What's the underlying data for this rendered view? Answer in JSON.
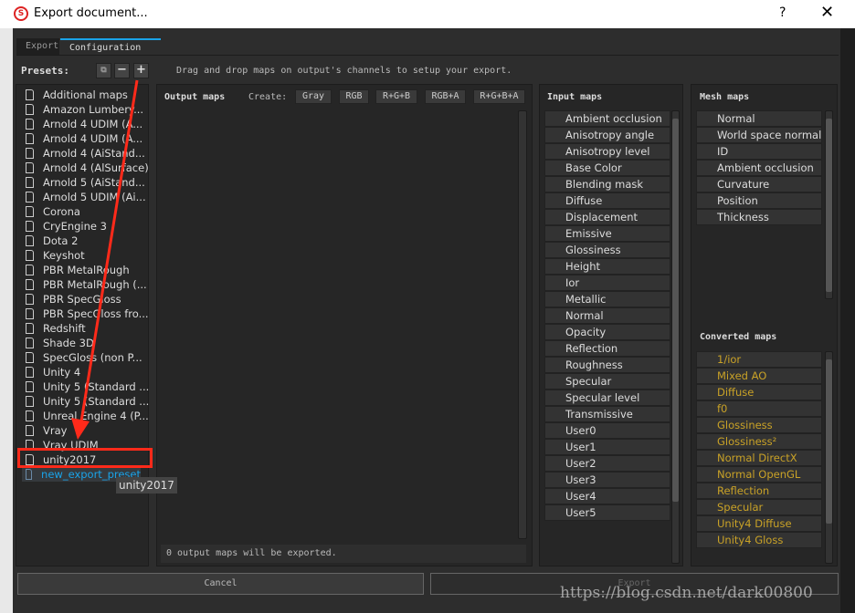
{
  "window": {
    "title": "Export document...",
    "help": "?",
    "close": "✕"
  },
  "tabs": [
    {
      "label": "Export"
    },
    {
      "label": "Configuration",
      "active": true
    }
  ],
  "presets": {
    "label": "Presets:",
    "buttons": [
      "⧉",
      "−",
      "+"
    ],
    "items": [
      "Additional maps",
      "Amazon Lumbery...",
      "Arnold 4  UDIM (A...",
      "Arnold 4  UDIM (A...",
      "Arnold 4 (AiStand...",
      "Arnold 4 (AlSurface)",
      "Arnold 5 (AiStand...",
      "Arnold 5 UDIM (Ai...",
      "Corona",
      "CryEngine 3",
      "Dota 2",
      "Keyshot",
      "PBR MetalRough",
      "PBR MetalRough (...",
      "PBR SpecGloss",
      "PBR SpecGloss fro...",
      "Redshift",
      "Shade 3D",
      "SpecGloss (non P...",
      "Unity 4",
      "Unity 5 (Standard ...",
      "Unity 5 (Standard ...",
      "Unreal Engine 4 (P...",
      "Vray",
      "Vray UDIM",
      "unity2017"
    ],
    "new_item": "new_export_preset",
    "tooltip": "unity2017"
  },
  "hint": "Drag and drop maps on output's channels to setup your export.",
  "output": {
    "title": "Output maps",
    "create_label": "Create:",
    "create_buttons": [
      "Gray",
      "RGB",
      "R+G+B",
      "RGB+A",
      "R+G+B+A"
    ],
    "status": "0 output maps will be exported."
  },
  "input_maps": {
    "title": "Input maps",
    "items": [
      "Ambient occlusion",
      "Anisotropy angle",
      "Anisotropy level",
      "Base Color",
      "Blending mask",
      "Diffuse",
      "Displacement",
      "Emissive",
      "Glossiness",
      "Height",
      "Ior",
      "Metallic",
      "Normal",
      "Opacity",
      "Reflection",
      "Roughness",
      "Specular",
      "Specular level",
      "Transmissive",
      "User0",
      "User1",
      "User2",
      "User3",
      "User4",
      "User5"
    ]
  },
  "mesh_maps": {
    "title": "Mesh maps",
    "items": [
      "Normal",
      "World space normal",
      "ID",
      "Ambient occlusion",
      "Curvature",
      "Position",
      "Thickness"
    ]
  },
  "converted_maps": {
    "title": "Converted maps",
    "items": [
      "1/ior",
      "Mixed AO",
      "Diffuse",
      "f0",
      "Glossiness",
      "Glossiness²",
      "Normal DirectX",
      "Normal OpenGL",
      "Reflection",
      "Specular",
      "Unity4 Diffuse",
      "Unity4 Gloss"
    ]
  },
  "footer": {
    "cancel": "Cancel",
    "export": "Export"
  },
  "watermark": "https://blog.csdn.net/dark00800",
  "colors": {
    "accent": "#1aa3e8",
    "converted": "#c9a227",
    "annotation": "#ff2a1a",
    "new_preset": "#1aa3e8"
  }
}
